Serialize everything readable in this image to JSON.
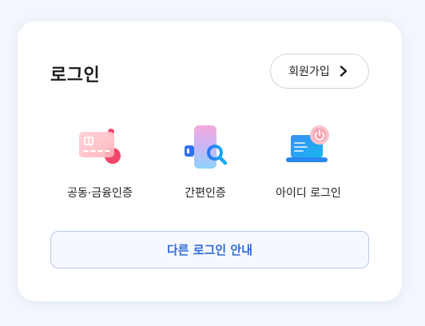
{
  "header": {
    "title": "로그인",
    "signup_label": "회원가입"
  },
  "methods": [
    {
      "label": "공동·금융인증",
      "icon": "certificate-card-icon"
    },
    {
      "label": "간편인증",
      "icon": "phone-search-icon"
    },
    {
      "label": "아이디 로그인",
      "icon": "laptop-power-icon"
    }
  ],
  "footer": {
    "other_login_label": "다른 로그인 안내"
  },
  "colors": {
    "accent": "#2f6bd8",
    "border_accent": "#b9c9ea",
    "card_bg": "#ffffff",
    "page_bg": "#f3f6fc"
  }
}
